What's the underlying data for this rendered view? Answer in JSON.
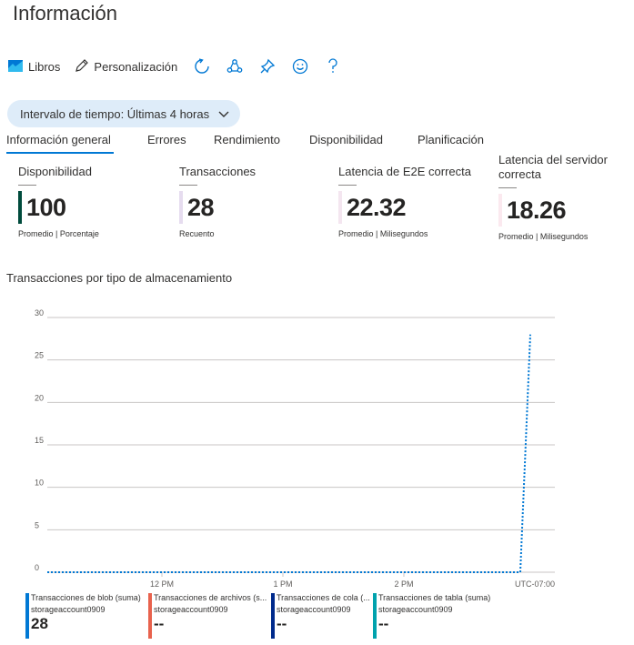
{
  "page": {
    "title": "Información"
  },
  "toolbar": {
    "libros_label": "Libros",
    "personalizacion_label": "Personalización",
    "icons": [
      "workbook-icon",
      "pencil-icon",
      "refresh-icon",
      "feedback-icon",
      "pin-icon",
      "smiley-icon",
      "help-icon"
    ]
  },
  "time_range": {
    "label": "Intervalo de tiempo: Últimas 4 horas"
  },
  "tabs": [
    {
      "label": "Información general",
      "active": true
    },
    {
      "label": "Errores"
    },
    {
      "label": "Rendimiento"
    },
    {
      "label": "Disponibilidad"
    },
    {
      "label": "Planificación"
    }
  ],
  "metrics": [
    {
      "title": "Disponibilidad",
      "value": "100",
      "sub": "Promedio | Porcentaje",
      "color": "#004b3c"
    },
    {
      "title": "Transacciones",
      "value": "28",
      "sub": "Recuento",
      "color": "#e6dcef"
    },
    {
      "title": "Latencia de E2E correcta",
      "value": "22.32",
      "sub": "Promedio | Milisegundos",
      "color": "#f4e6f0"
    },
    {
      "title": "Latencia del servidor correcta",
      "value": "18.26",
      "sub": "Promedio | Milisegundos",
      "color": "#fbe9ef"
    }
  ],
  "chart_title": "Transacciones por tipo de almacenamiento",
  "chart_data": {
    "type": "line",
    "title": "Transacciones por tipo de almacenamiento",
    "ylim": [
      0,
      30
    ],
    "yticks": [
      0,
      5,
      10,
      15,
      20,
      25,
      30
    ],
    "xticks": [
      "12 PM",
      "1 PM",
      "2 PM",
      "UTC-07:00"
    ],
    "x": [
      "11:11 AM",
      "11:30 AM",
      "12:00 PM",
      "12:30 PM",
      "1:00 PM",
      "1:30 PM",
      "2:00 PM",
      "2:30 PM",
      "2:55 PM",
      "3:00 PM"
    ],
    "series": [
      {
        "name": "Transacciones de blob (suma)",
        "values": [
          0,
          0,
          0,
          0,
          0,
          0,
          0,
          0,
          0,
          28
        ],
        "color": "#0078d4",
        "style": "dotted"
      }
    ],
    "grid": true
  },
  "legend": [
    {
      "name": "Transacciones de blob (suma)",
      "account": "storageaccount0909",
      "value": "28",
      "color": "#0078d4"
    },
    {
      "name": "Transacciones de archivos (s...",
      "account": "storageaccount0909",
      "value": "--",
      "color": "#e8624d"
    },
    {
      "name": "Transacciones de cola (...",
      "account": "storageaccount0909",
      "value": "--",
      "color": "#002a8c"
    },
    {
      "name": "Transacciones de tabla (suma)",
      "account": "storageaccount0909",
      "value": "--",
      "color": "#00a2ad"
    }
  ]
}
